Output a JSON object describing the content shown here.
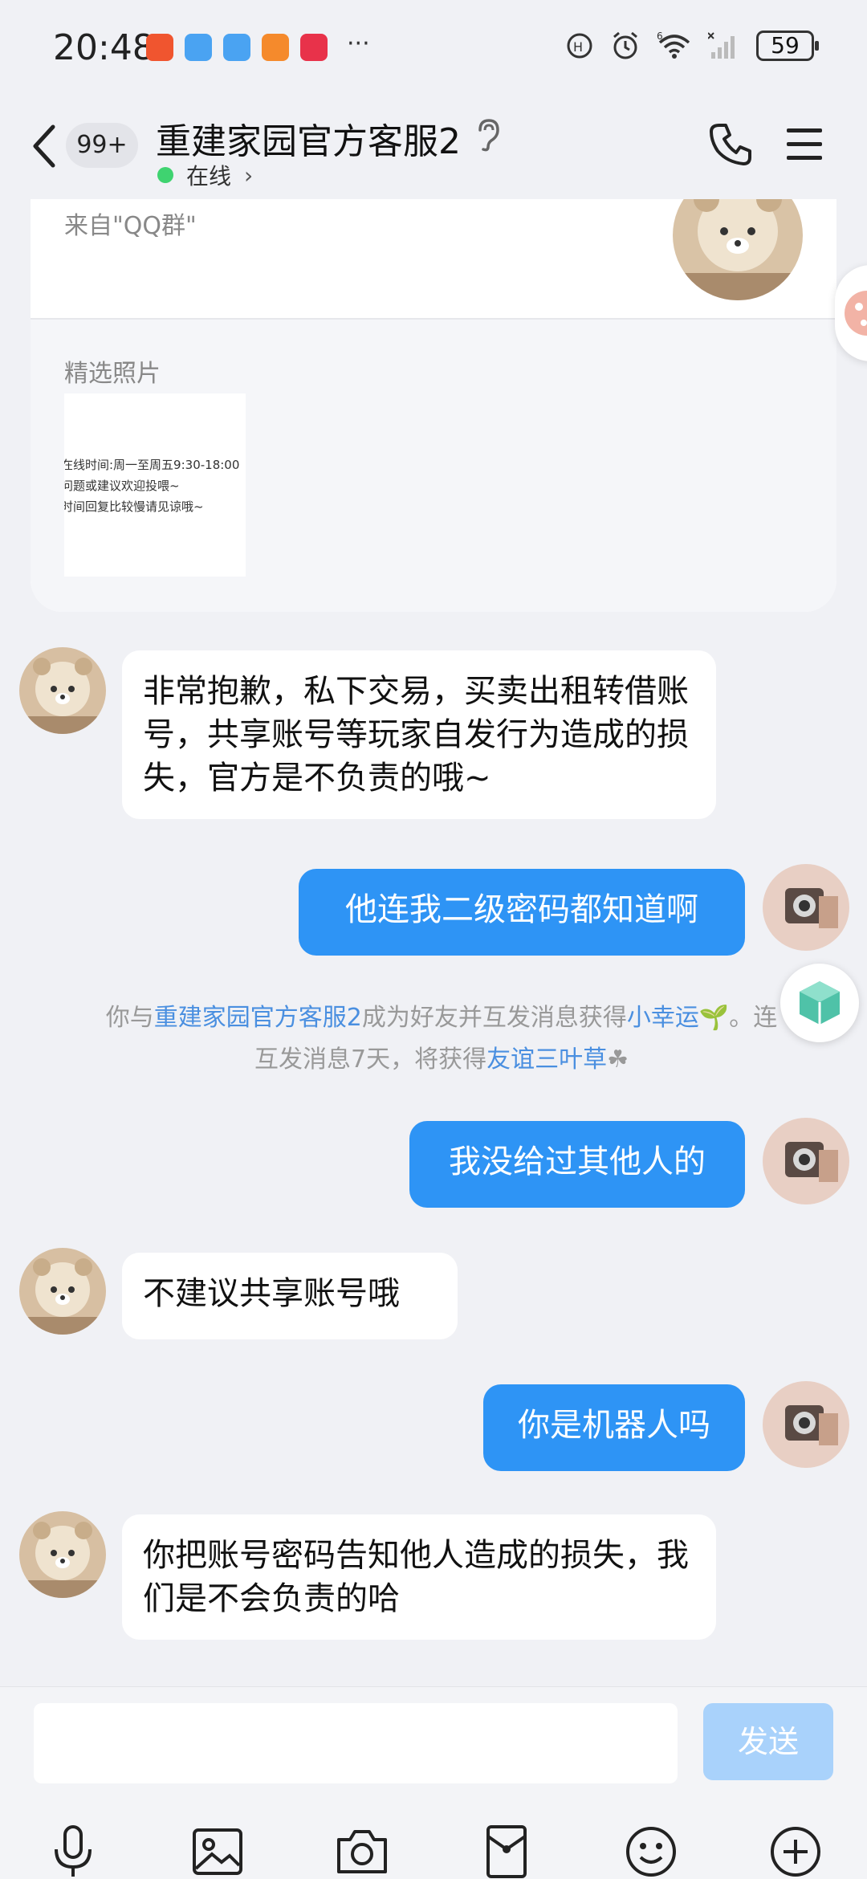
{
  "status_bar": {
    "time": "20:48",
    "more_indicator": "···",
    "signal_label": "6",
    "battery": "59"
  },
  "header": {
    "unread_count": "99+",
    "title": "重建家园官方客服2",
    "status": "在线",
    "status_color": "#3fd370"
  },
  "profile_card": {
    "source": "来自\"QQ群\"",
    "photos_label": "精选照片",
    "photo_lines": [
      "在线时间:周一至周五9:30-18:00",
      "问题或建议欢迎投喂~",
      "时间回复比较慢请见谅哦~"
    ]
  },
  "messages": [
    {
      "side": "in",
      "text": "非常抱歉，私下交易，买卖出租转借账号，共享账号等玩家自发行为造成的损失，官方是不负责的哦~"
    },
    {
      "side": "out",
      "text": "他连我二级密码都知道啊"
    },
    {
      "side": "out",
      "text": "我没给过其他人的"
    },
    {
      "side": "in",
      "text": "不建议共享账号哦"
    },
    {
      "side": "out",
      "text": "你是机器人吗"
    },
    {
      "side": "in",
      "text": "你把账号密码告知他人造成的损失，我们是不会负责的哈"
    }
  ],
  "system_message": {
    "p1": "你与",
    "name": "重建家园官方客服2",
    "p2": "成为好友并互发消息获得",
    "lucky": "小幸运",
    "p3": "。连",
    "p4": "互发消息7天，将获得",
    "friendship": "友谊三叶草"
  },
  "input": {
    "placeholder": "",
    "send_label": "发送"
  },
  "toolbar_icons": [
    "microphone-icon",
    "image-icon",
    "camera-icon",
    "red-packet-icon",
    "emoji-icon",
    "plus-icon"
  ],
  "colors": {
    "accent": "#2e94f5",
    "send_disabled": "#a9d2fb",
    "link": "#4a8fe0",
    "background": "#f0f1f5"
  }
}
